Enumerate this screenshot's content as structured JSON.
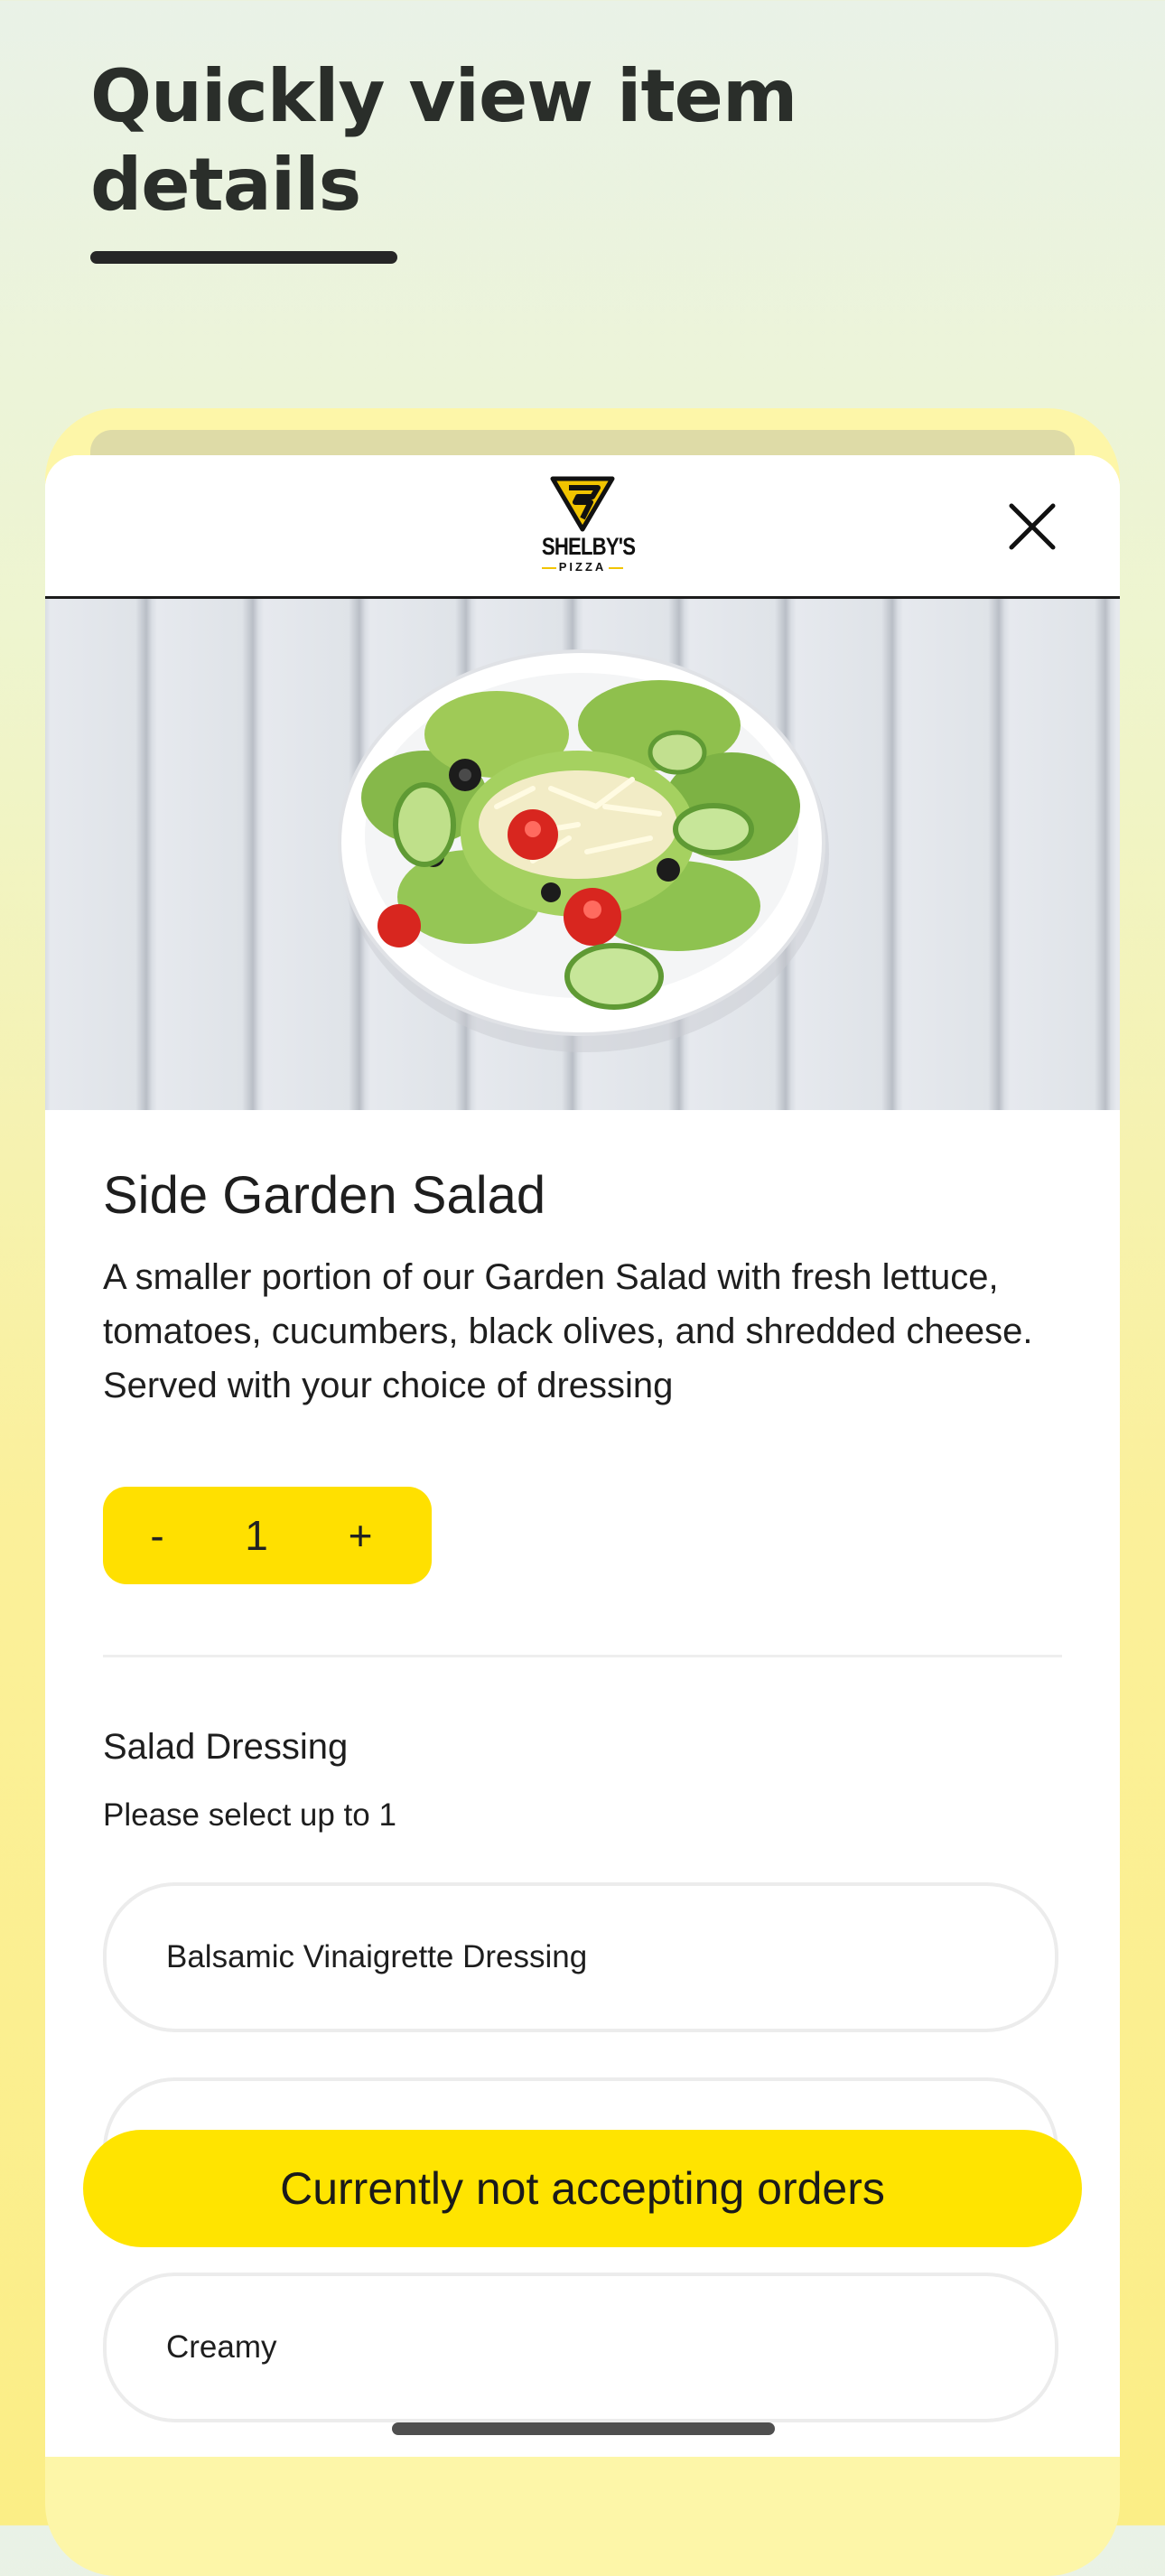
{
  "promo": {
    "headline": "Quickly view item details"
  },
  "header": {
    "brand_name": "SHELBY'S",
    "brand_sub": "PIZZA",
    "close_icon": "close-icon"
  },
  "item": {
    "image_icon": "salad-photo",
    "title": "Side Garden Salad",
    "description": "A smaller portion of our Garden Salad with fresh lettuce, tomatoes, cucumbers, black olives, and shredded cheese. Served with your choice of dressing",
    "quantity": {
      "minus_label": "-",
      "value": "1",
      "plus_label": "+"
    }
  },
  "dressing": {
    "title": "Salad Dressing",
    "subtitle": "Please select up to 1",
    "options": [
      {
        "label": "Balsamic Vinaigrette Dressing"
      },
      {
        "label": ""
      },
      {
        "label": "Creamy"
      }
    ]
  },
  "cta": {
    "label": "Currently not accepting orders"
  },
  "colors": {
    "accent": "#ffe400",
    "text": "#1e1e1e"
  }
}
